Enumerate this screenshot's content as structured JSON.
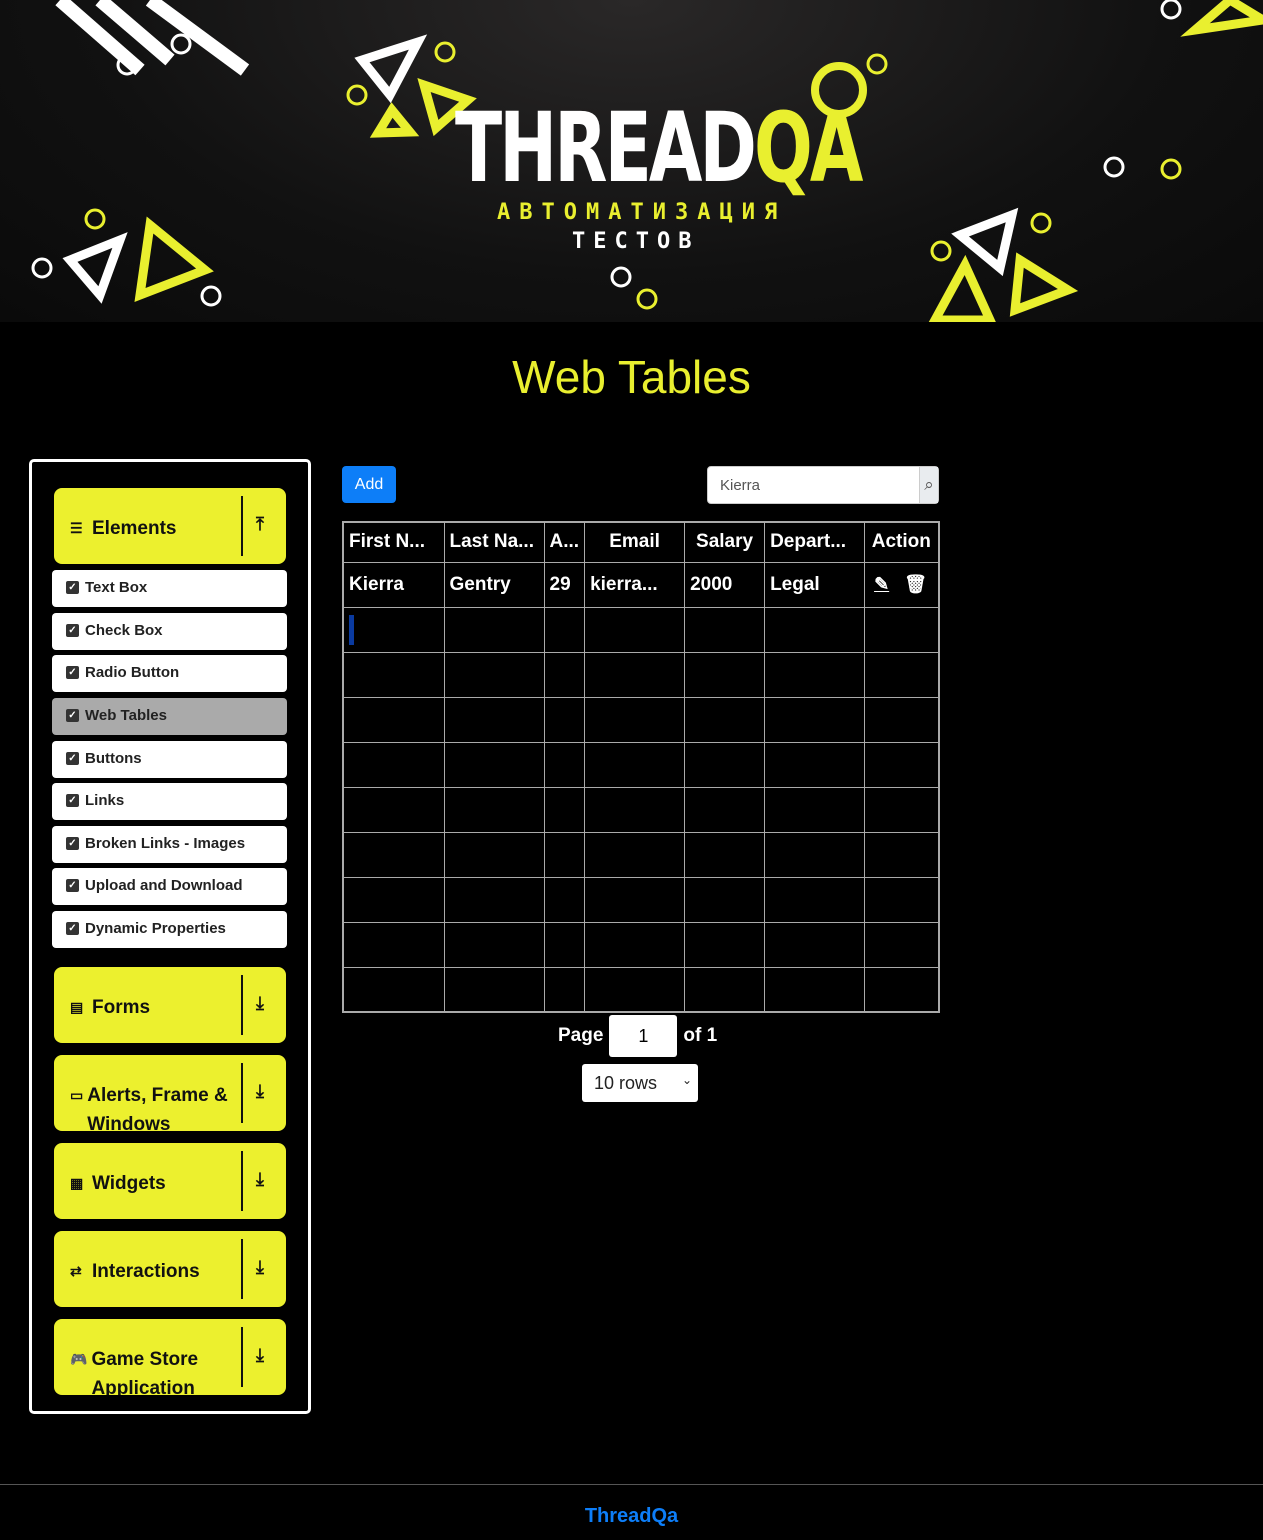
{
  "banner": {
    "logo_main": "THREAD",
    "logo_accent": "QA",
    "line1": "АВТОМАТИЗАЦИЯ",
    "line2": "ТЕСТОВ"
  },
  "page_title": "Web Tables",
  "sidebar": {
    "groups": [
      {
        "label": "Elements",
        "icon": "hamburger-icon",
        "arrow": "⤒"
      },
      {
        "label": "Forms",
        "icon": "document-icon",
        "arrow": "⤓"
      },
      {
        "label": "Alerts, Frame & Windows",
        "icon": "window-icon",
        "arrow": "⤓"
      },
      {
        "label": "Widgets",
        "icon": "widgets-icon",
        "arrow": "⤓"
      },
      {
        "label": "Interactions",
        "icon": "interactions-icon",
        "arrow": "⤓"
      },
      {
        "label": "Game Store Application",
        "icon": "gamepad-icon",
        "arrow": "⤓"
      }
    ],
    "items": [
      "Text Box",
      "Check Box",
      "Radio Button",
      "Web Tables",
      "Buttons",
      "Links",
      "Broken Links - Images",
      "Upload and Download",
      "Dynamic Properties"
    ],
    "active": "Web Tables"
  },
  "toolbar": {
    "add_label": "Add",
    "search_value": "Kierra"
  },
  "table": {
    "headers": [
      "First N...",
      "Last Na...",
      "A...",
      "Email",
      "Salary",
      "Depart...",
      "Action"
    ],
    "rows": [
      [
        "Kierra",
        "Gentry",
        "29",
        "kierra...",
        "2000",
        "Legal"
      ]
    ]
  },
  "pagination": {
    "page_label": "Page",
    "page": "1",
    "of_label": "of 1",
    "rows_select": "10 rows"
  },
  "footer": {
    "text": "ThreadQa"
  },
  "colors": {
    "accent": "#ecf02e",
    "primary": "#0d7ef8"
  }
}
